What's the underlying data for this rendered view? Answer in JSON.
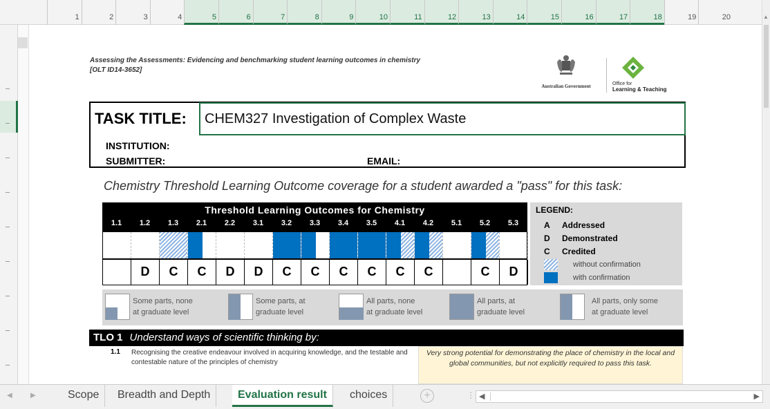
{
  "ruler": {
    "numbers": [
      "1",
      "2",
      "3",
      "4",
      "5",
      "6",
      "7",
      "8",
      "9",
      "10",
      "11",
      "12",
      "13",
      "14",
      "15",
      "16",
      "17",
      "18",
      "19",
      "20"
    ],
    "selected_from": "5",
    "selected_to": "18"
  },
  "header": {
    "project_line1": "Assessing the Assessments: Evidencing and benchmarking student learning outcomes in chemistry",
    "project_line2": "[OLT ID14-3652]",
    "govt_logo_text": "Australian Government",
    "olt_logo_line1": "Office for",
    "olt_logo_line2": "Learning & Teaching"
  },
  "task": {
    "title_label": "TASK TITLE:",
    "title_value": "CHEM327 Investigation of Complex Waste",
    "institution_label": "INSTITUTION:",
    "submitter_label": "SUBMITTER:",
    "email_label": "EMAIL:"
  },
  "coverage_heading": "Chemistry Threshold Learning Outcome coverage for a student awarded a \"pass\" for this task:",
  "tlo_table": {
    "title": "Threshold Learning Outcomes for Chemistry",
    "codes": [
      "1.1",
      "1.2",
      "1.3",
      "2.1",
      "2.2",
      "3.1",
      "3.2",
      "3.3",
      "3.4",
      "3.5",
      "4.1",
      "4.2",
      "5.1",
      "5.2",
      "5.3"
    ],
    "levels": [
      "",
      "D",
      "C",
      "C",
      "D",
      "D",
      "C",
      "C",
      "C",
      "C",
      "C",
      "C",
      "",
      "C",
      "D"
    ],
    "coverage": [
      "none",
      "none",
      "hatch-full",
      "solid-left",
      "none",
      "none",
      "solid-full",
      "solid-left",
      "solid-full",
      "solid-full",
      "solid-left-hatch-right",
      "solid-left-hatch-right",
      "none",
      "solid-left-hatch-right",
      "none"
    ]
  },
  "legend": {
    "title": "LEGEND:",
    "items": [
      {
        "key": "A",
        "label": "Addressed"
      },
      {
        "key": "D",
        "label": "Demonstrated"
      },
      {
        "key": "C",
        "label": "Credited"
      }
    ],
    "hatch_label": "without confirmation",
    "solid_label": "with confirmation",
    "hatch_color": "#8db4e2",
    "solid_color": "#0070c0"
  },
  "key_band": [
    {
      "line1": "Some parts, none",
      "line2": "at graduate level"
    },
    {
      "line1": "Some parts, at",
      "line2": "graduate level"
    },
    {
      "line1": "All parts,  none",
      "line2": "at graduate level"
    },
    {
      "line1": "All parts, at",
      "line2": "graduate level"
    },
    {
      "line1": "All parts, only some",
      "line2": "at graduate level"
    }
  ],
  "tlo1": {
    "label": "TLO 1",
    "heading": "Understand ways of scientific thinking by:",
    "item_number": "1.1",
    "item_text": "Recognising the creative endeavour involved in acquiring knowledge, and the testable  and contestable nature of the principles of chemistry",
    "note": "Very strong potential for demonstrating the place of chemistry in the local and global communities, but not explicitly required to pass this task."
  },
  "sheet_tabs": [
    "Scope",
    "Breadth and Depth",
    "Evaluation result",
    "choices"
  ],
  "active_tab": "Evaluation result",
  "colors": {
    "excel_green": "#217346",
    "tlo_header_bg": "#000000",
    "legend_bg": "#d9d9d9",
    "note_bg": "#fff5d6"
  }
}
